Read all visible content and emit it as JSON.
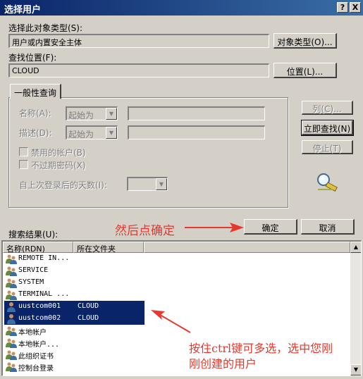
{
  "window": {
    "title": "选择用户",
    "help_btn": "?",
    "close_btn": "X"
  },
  "object_type": {
    "label": "选择此对象类型(S):",
    "value": "用户或内置安全主体",
    "button": "对象类型(O)..."
  },
  "location": {
    "label": "查找位置(F):",
    "value": "CLOUD",
    "button": "位置(L)..."
  },
  "query_tab": {
    "label": "一般性查询"
  },
  "query": {
    "name_label": "名称(A):",
    "name_mode": "起始为",
    "desc_label": "描述(D):",
    "desc_mode": "起始为",
    "disabled_accounts": "禁用的帐户(B)",
    "non_expiring": "不过期密码(X)",
    "days_label": "自上次登录后的天数(I):"
  },
  "side_buttons": {
    "columns": "列(C)...",
    "find_now": "立即查找(N)",
    "stop": "停止(T)"
  },
  "actions": {
    "ok": "确定",
    "cancel": "取消"
  },
  "results": {
    "label": "搜索结果(U):",
    "columns": [
      "名称(RDN)",
      "所在文件夹"
    ],
    "rows": [
      {
        "name": "REMOTE IN...",
        "folder": "",
        "selected": false,
        "icon": "group-icon"
      },
      {
        "name": "SERVICE",
        "folder": "",
        "selected": false,
        "icon": "group-icon"
      },
      {
        "name": "SYSTEM",
        "folder": "",
        "selected": false,
        "icon": "group-icon"
      },
      {
        "name": "TERMINAL ...",
        "folder": "",
        "selected": false,
        "icon": "group-icon"
      },
      {
        "name": "uustcom001",
        "folder": "CLOUD",
        "selected": true,
        "icon": "user-icon"
      },
      {
        "name": "uustcom002",
        "folder": "CLOUD",
        "selected": true,
        "icon": "user-icon"
      },
      {
        "name": "本地帐户",
        "folder": "",
        "selected": false,
        "icon": "group-icon"
      },
      {
        "name": "本地帐户...",
        "folder": "",
        "selected": false,
        "icon": "group-icon"
      },
      {
        "name": "此组织证书",
        "folder": "",
        "selected": false,
        "icon": "group-icon"
      },
      {
        "name": "控制台登录",
        "folder": "",
        "selected": false,
        "icon": "group-icon"
      }
    ]
  },
  "annotations": {
    "then_click_ok": "然后点确定",
    "ctrl_line1": "按住ctrl键可多选，选中您刚",
    "ctrl_line2": "刚创建的用户",
    "color": "#e8382e"
  }
}
